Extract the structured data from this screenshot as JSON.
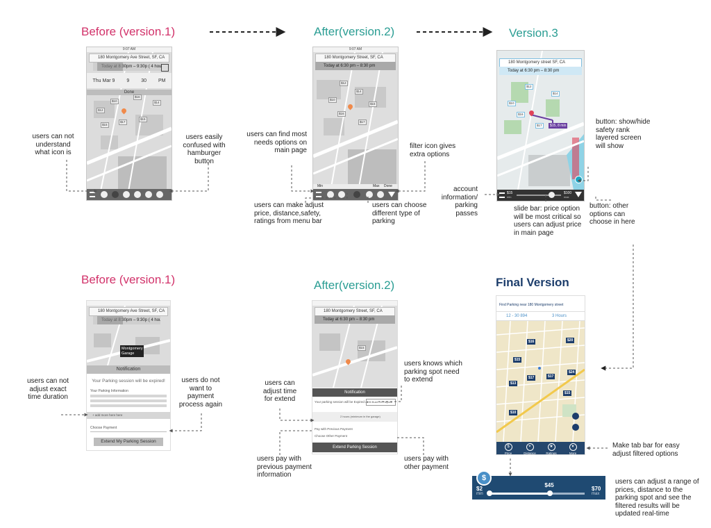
{
  "titles": {
    "top_before": "Before (version.1)",
    "top_after": "After(version.2)",
    "top_v3": "Version.3",
    "bottom_before": "Before (version.1)",
    "bottom_after": "After(version.2)",
    "final": "Final Version"
  },
  "phones": {
    "v1_top": {
      "status": "9:07 AM",
      "address": "180 Montgomery Ave Street, SF, CA",
      "time": "Today at 8:30pm – 9:30p ( 4 hours )",
      "picker": [
        "Thu Mar 9",
        "9",
        "30",
        "PM"
      ],
      "done": "Done",
      "prices": [
        "$10",
        "$16",
        "$14",
        "$12",
        "$15",
        "$17",
        "$15"
      ]
    },
    "v2_top": {
      "status": "9:07 AM",
      "address": "180 Montgomery Street, SF, CA",
      "time": "Today at 6:30 pm – 8:30 pm",
      "tab_labels": [
        "Min",
        "Max",
        "Done"
      ]
    },
    "v3": {
      "address": "180 Montgomery street SF, CA",
      "time": "Today at 6:30 pm – 8:30 pm",
      "min": "$15",
      "max": "$100",
      "min_label": "min",
      "max_label": "max"
    },
    "v1_bottom": {
      "address": "180 Montgomery Ave Street, SF, CA",
      "time": "Today at 8:30pm – 9:30p ( 4 hours )",
      "garage": "Montgomery Garage",
      "notification": "Notification",
      "message": "Your Parking session will be expired!",
      "info": "Your Parking Information",
      "add_more": "+ add more here here",
      "choose_payment": "Choose Payment",
      "extend": "Extend My Parking Session"
    },
    "v2_bottom": {
      "address": "180 Montgomery Street, SF, CA",
      "time": "Today at 6:30 pm – 8:30 pm",
      "notification": "Notification",
      "message": "Your parking session will be Expired at",
      "location": "335 Bush St Prepark",
      "row_extend": "2 hours (minimum in the garage)",
      "pay_previous": "Pay with Previous Payment",
      "pay_other": "Choose Other Payment",
      "extend": "Extend Parking Session"
    },
    "final": {
      "header": "Find Parking near 180 Montgomery street",
      "range": "12 - 30 894",
      "hours": "3 Hours",
      "prices": [
        "$16",
        "$20",
        "$15",
        "$17",
        "$13",
        "$17",
        "$24",
        "$15",
        "$10"
      ],
      "tabs": [
        "Price",
        "Distance",
        "Ratings",
        "More"
      ]
    }
  },
  "slider": {
    "min": "$2",
    "min_label": "min",
    "mid": "$45",
    "max": "$70",
    "max_label": "max",
    "level": 0.64
  },
  "notes": {
    "n1": "users can not understand what icon is",
    "n2": "users easily confused with hamburger button",
    "n3": "users can find most needs options on main page",
    "n4": "filter icon gives extra options",
    "n5": "users can make adjust price, distance,safety, ratings from menu bar",
    "n6": "users can choose different type of parking",
    "n7": "button: show/hide safety rank layered screen will show",
    "n8": "account information/ parking passes",
    "n9": "slide bar: price option will be most critical so users can adjust price in main page",
    "n10": "button: other options can choose in here",
    "n11": "users can not adjust exact time duration",
    "n12": "users do not want to payment process again",
    "n13": "users can adjust time for extend",
    "n14": "users knows which parking spot need to extend",
    "n15": "users pay with previous payment information",
    "n16": "users pay with other payment",
    "n17": "Make tab bar for easy adjust filtered options",
    "n18": "users can adjust a range of prices, distance to the parking spot  and see the filtered results will be updated real-time"
  },
  "colors": {
    "before": "#d2326a",
    "after": "#2a9d93",
    "final": "#1c3d6b",
    "pin": "#f08a4b"
  }
}
